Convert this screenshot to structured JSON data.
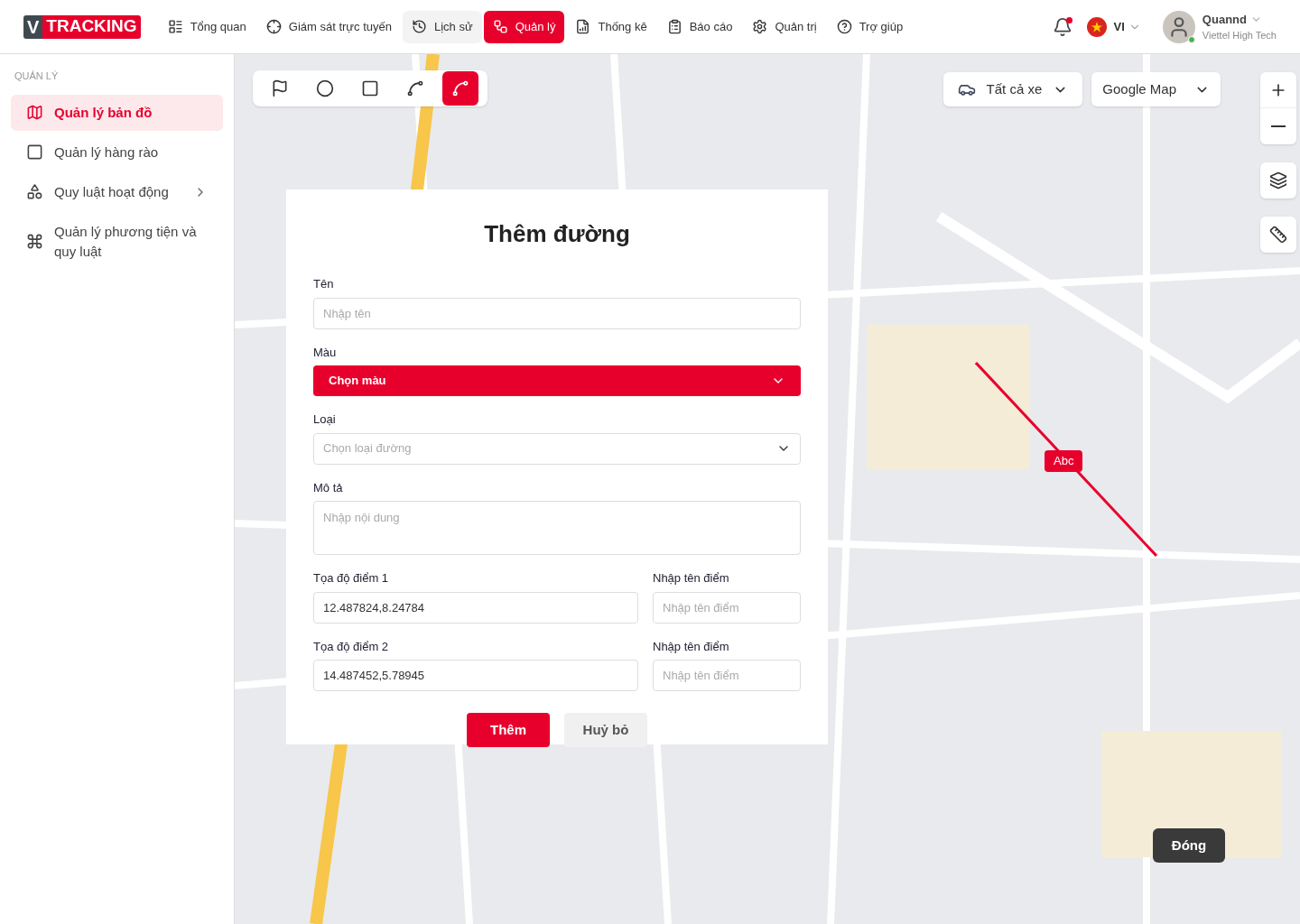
{
  "header": {
    "logo": {
      "letter": "V",
      "text": "TRACKING"
    },
    "nav": [
      {
        "label": "Tổng quan",
        "selected": false,
        "hovered": false
      },
      {
        "label": "Giám sát trực tuyến",
        "selected": false,
        "hovered": false
      },
      {
        "label": "Lịch sử",
        "selected": false,
        "hovered": true
      },
      {
        "label": "Quản lý",
        "selected": true,
        "hovered": false
      },
      {
        "label": "Thống kê",
        "selected": false,
        "hovered": false
      },
      {
        "label": "Báo cáo",
        "selected": false,
        "hovered": false
      },
      {
        "label": "Quản trị",
        "selected": false,
        "hovered": false
      },
      {
        "label": "Trợ giúp",
        "selected": false,
        "hovered": false
      }
    ],
    "notifications": {
      "unread": true
    },
    "language": "VI",
    "user": {
      "name": "Quannd",
      "company": "Viettel High Tech",
      "online": true
    }
  },
  "sidebar": {
    "section": "QUẢN LÝ",
    "items": [
      {
        "label": "Quản lý bản đồ",
        "selected": true,
        "has_submenu": false
      },
      {
        "label": "Quản lý hàng rào",
        "selected": false,
        "has_submenu": false
      },
      {
        "label": "Quy luật hoạt động",
        "selected": false,
        "has_submenu": true
      },
      {
        "label": "Quản lý phương tiện và quy luật",
        "selected": false,
        "has_submenu": false
      }
    ]
  },
  "map": {
    "tools": [
      {
        "selected": false
      },
      {
        "selected": false
      },
      {
        "selected": false
      },
      {
        "selected": false
      },
      {
        "selected": true
      }
    ],
    "vehicle_filter": "Tất cả xe",
    "map_type": "Google Map",
    "route": {
      "label": "Abc",
      "color": "#e8002d"
    },
    "close_button": "Đóng"
  },
  "dialog": {
    "title": "Thêm đường",
    "fields": [
      {
        "kind": "input",
        "label": "Tên",
        "placeholder": "Nhập tên"
      },
      {
        "kind": "color",
        "label": "Màu",
        "placeholder": "Chọn màu",
        "color": "#e8002d"
      },
      {
        "kind": "select",
        "label": "Loại",
        "placeholder": "Chọn loại đường"
      },
      {
        "kind": "textarea",
        "label": "Mô tả",
        "placeholder": "Nhập nội dung"
      }
    ],
    "points": [
      {
        "label": "Tọa độ điểm 1",
        "value": "12.487824,8.24784",
        "name_label": "Nhập tên điểm",
        "name_placeholder": "Nhập tên điểm"
      },
      {
        "label": "Tọa độ điểm 2",
        "value": "14.487452,5.78945",
        "name_label": "Nhập tên điểm",
        "name_placeholder": "Nhập tên điểm"
      }
    ],
    "buttons": [
      {
        "label": "Thêm",
        "kind": "primary"
      },
      {
        "label": "Huỷ bỏ",
        "kind": "secondary"
      }
    ]
  }
}
